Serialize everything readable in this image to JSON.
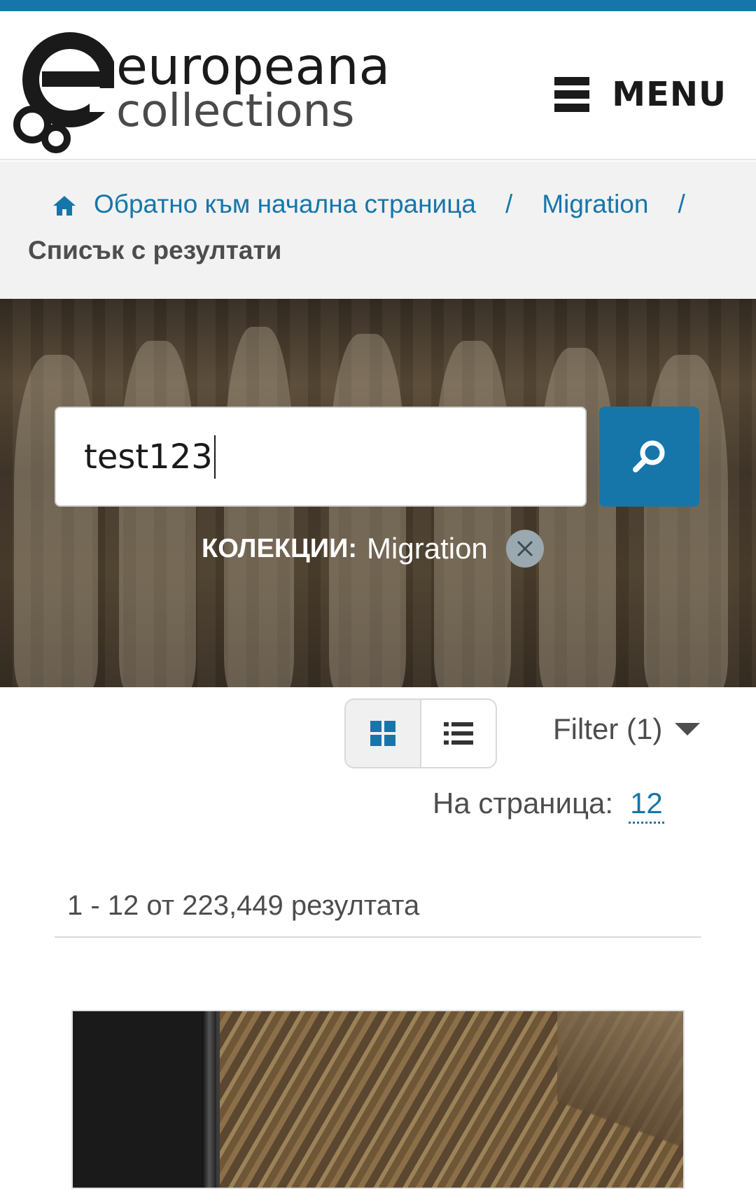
{
  "header": {
    "logo_title": "europeana",
    "logo_subtitle": "collections",
    "menu_label": "MENU"
  },
  "breadcrumb": {
    "home_label": "Обратно към начална страница",
    "separator": "/",
    "collection_label": "Migration",
    "current_label": "Списък с резултати"
  },
  "search": {
    "query": "test123",
    "button_icon": "search-icon"
  },
  "active_filter": {
    "key": "КОЛЕКЦИИ:",
    "value": "Migration",
    "remove_icon": "close-icon"
  },
  "toolbar": {
    "grid_view_icon": "grid-view-icon",
    "list_view_icon": "list-view-icon",
    "filter_label": "Filter (1)",
    "per_page_label": "На страница:",
    "per_page_value": "12"
  },
  "results": {
    "summary": "1 - 12 от 223,449 резултата"
  },
  "colors": {
    "brand_blue": "#1676aa",
    "text": "#4d4d4d",
    "breadcrumb_bg": "#f2f2f2"
  }
}
